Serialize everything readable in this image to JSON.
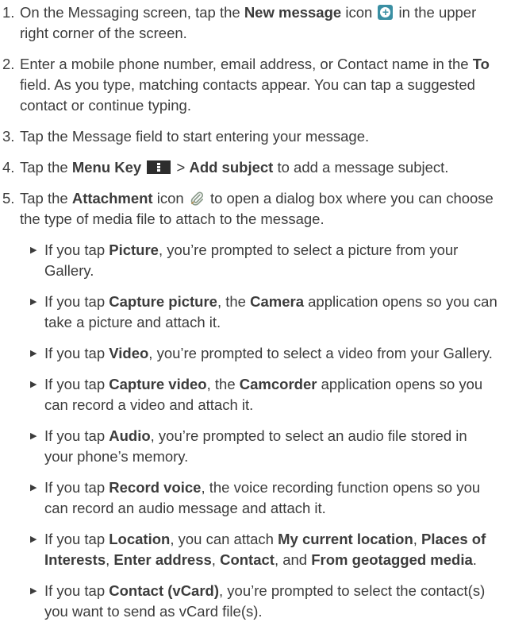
{
  "steps": [
    {
      "num": "1.",
      "t1": "On the Messaging screen, tap the ",
      "b1": "New message",
      "t2": " icon ",
      "t3": " in the upper right corner of the screen."
    },
    {
      "num": "2.",
      "t1": "Enter a mobile phone number, email address, or Contact name in the ",
      "b1": "To",
      "t2": " field. As you type, matching contacts appear. You can tap a suggested contact or continue typing."
    },
    {
      "num": "3.",
      "t1": "Tap the Message field to start entering your message."
    },
    {
      "num": "4.",
      "t1": "Tap the ",
      "b1": "Menu Key",
      "t2": " > ",
      "b2": "Add subject",
      "t3": " to add a message subject."
    },
    {
      "num": "5.",
      "t1": "Tap the ",
      "b1": "Attachment",
      "t2": " icon ",
      "t3": " to open a dialog box where you can choose the type of media file to attach to the message."
    }
  ],
  "bullet_glyph": "▶",
  "subitems": [
    {
      "t1": "If you tap ",
      "b1": "Picture",
      "t2": ", you’re prompted to select a picture from your Gallery."
    },
    {
      "t1": "If you tap ",
      "b1": "Capture picture",
      "t2": ", the ",
      "b2": "Camera",
      "t3": " application opens so you can take a picture and attach it."
    },
    {
      "t1": "If you tap ",
      "b1": "Video",
      "t2": ", you’re prompted to select a video from your Gallery."
    },
    {
      "t1": "If you tap ",
      "b1": "Capture video",
      "t2": ", the ",
      "b2": "Camcorder",
      "t3": " application opens so you can record a video and attach it."
    },
    {
      "t1": "If you tap ",
      "b1": "Audio",
      "t2": ", you’re prompted to select an audio file stored in your phone’s memory."
    },
    {
      "t1": "If you tap ",
      "b1": "Record voice",
      "t2": ", the voice recording function opens so you can record an audio message and attach it."
    },
    {
      "t1": "If you tap ",
      "b1": "Location",
      "t2": ", you can attach ",
      "b2": "My current location",
      "t3": ", ",
      "b3": "Places of Interests",
      "t4": ", ",
      "b4": "Enter address",
      "t5": ", ",
      "b5": "Contact",
      "t6": ", and ",
      "b6": "From geotagged media",
      "t7": "."
    },
    {
      "t1": "If you tap ",
      "b1": "Contact (vCard)",
      "t2": ", you’re prompted to select the contact(s) you want to send as vCard file(s)."
    }
  ],
  "icons": {
    "new_message": "new-message-icon",
    "menu_key": "menu-key-icon",
    "attachment": "paperclip-icon"
  },
  "colors": {
    "text": "#3c3c3c",
    "new_message_icon": "#3a8fa3",
    "menu_key_icon": "#2d2d2d"
  }
}
